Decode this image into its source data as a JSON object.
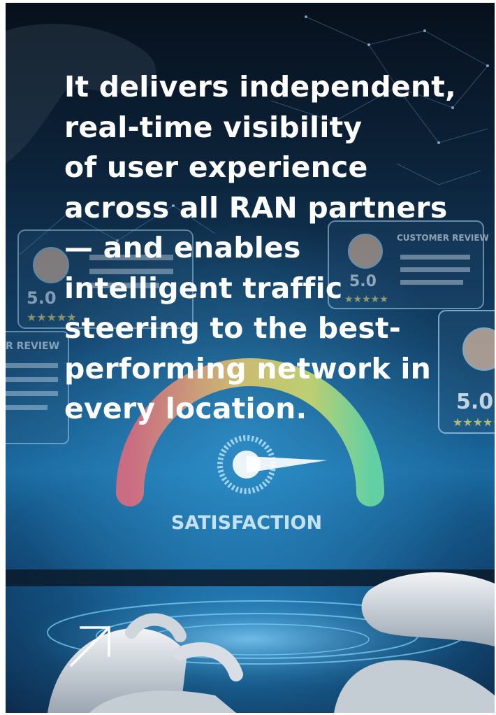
{
  "headline_lines": [
    "It delivers independent,",
    "real-time visibility",
    "of user experience",
    "across all RAN partners",
    "— and enables",
    "intelligent traffic",
    "steering to the best-",
    "performing network in",
    "every location."
  ],
  "background": {
    "gauge_label": "SATISFACTION",
    "rating_value": "5.0",
    "rating_value_right": "5.0",
    "review_header": "CUSTOMER REVIEW",
    "review_header_left": "R REVIEW",
    "stars": "★★★★★"
  },
  "link_icon": "arrow-up-right-icon",
  "colors": {
    "text": "#ffffff",
    "gauge_red": "#e86a7a",
    "gauge_yellow": "#e8d86a",
    "gauge_green": "#6ee0a0",
    "accent_blue": "#3aa8e6"
  }
}
